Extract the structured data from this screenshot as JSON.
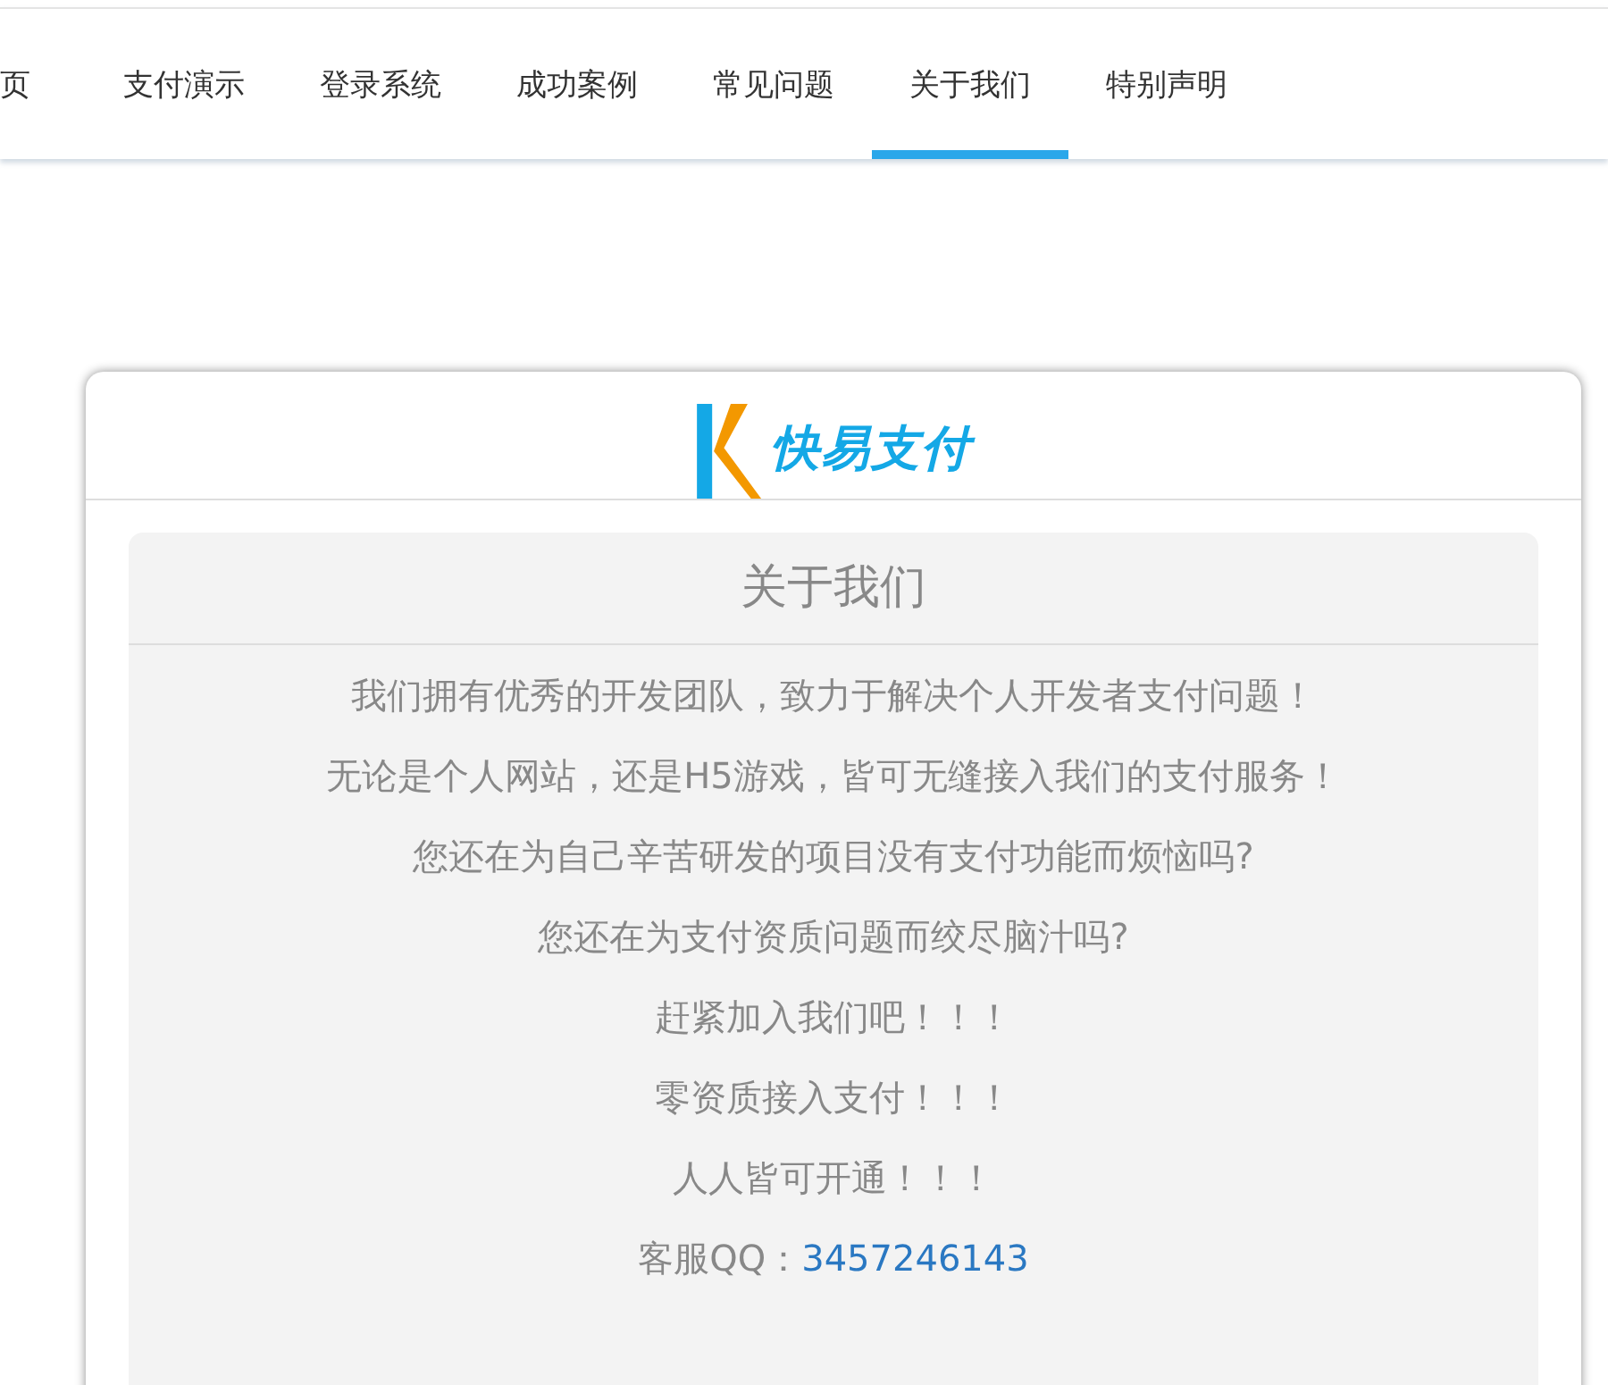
{
  "nav": {
    "items": [
      {
        "label": "页",
        "selected": false
      },
      {
        "label": "支付演示",
        "selected": false
      },
      {
        "label": "登录系统",
        "selected": false
      },
      {
        "label": "成功案例",
        "selected": false
      },
      {
        "label": "常见问题",
        "selected": false
      },
      {
        "label": "关于我们",
        "selected": true
      },
      {
        "label": "特别声明",
        "selected": false
      }
    ]
  },
  "card": {
    "logo_text": "快易支付",
    "title": "关于我们",
    "lines": [
      "我们拥有优秀的开发团队，致力于解决个人开发者支付问题！",
      "无论是个人网站，还是H5游戏，皆可无缝接入我们的支付服务！",
      "您还在为自己辛苦研发的项目没有支付功能而烦恼吗?",
      "您还在为支付资质问题而绞尽脑汁吗?",
      "赶紧加入我们吧！！！",
      "零资质接入支付！！！",
      "人人皆可开通！！！"
    ],
    "contact_label": "客服QQ：",
    "contact_value": "3457246143"
  }
}
